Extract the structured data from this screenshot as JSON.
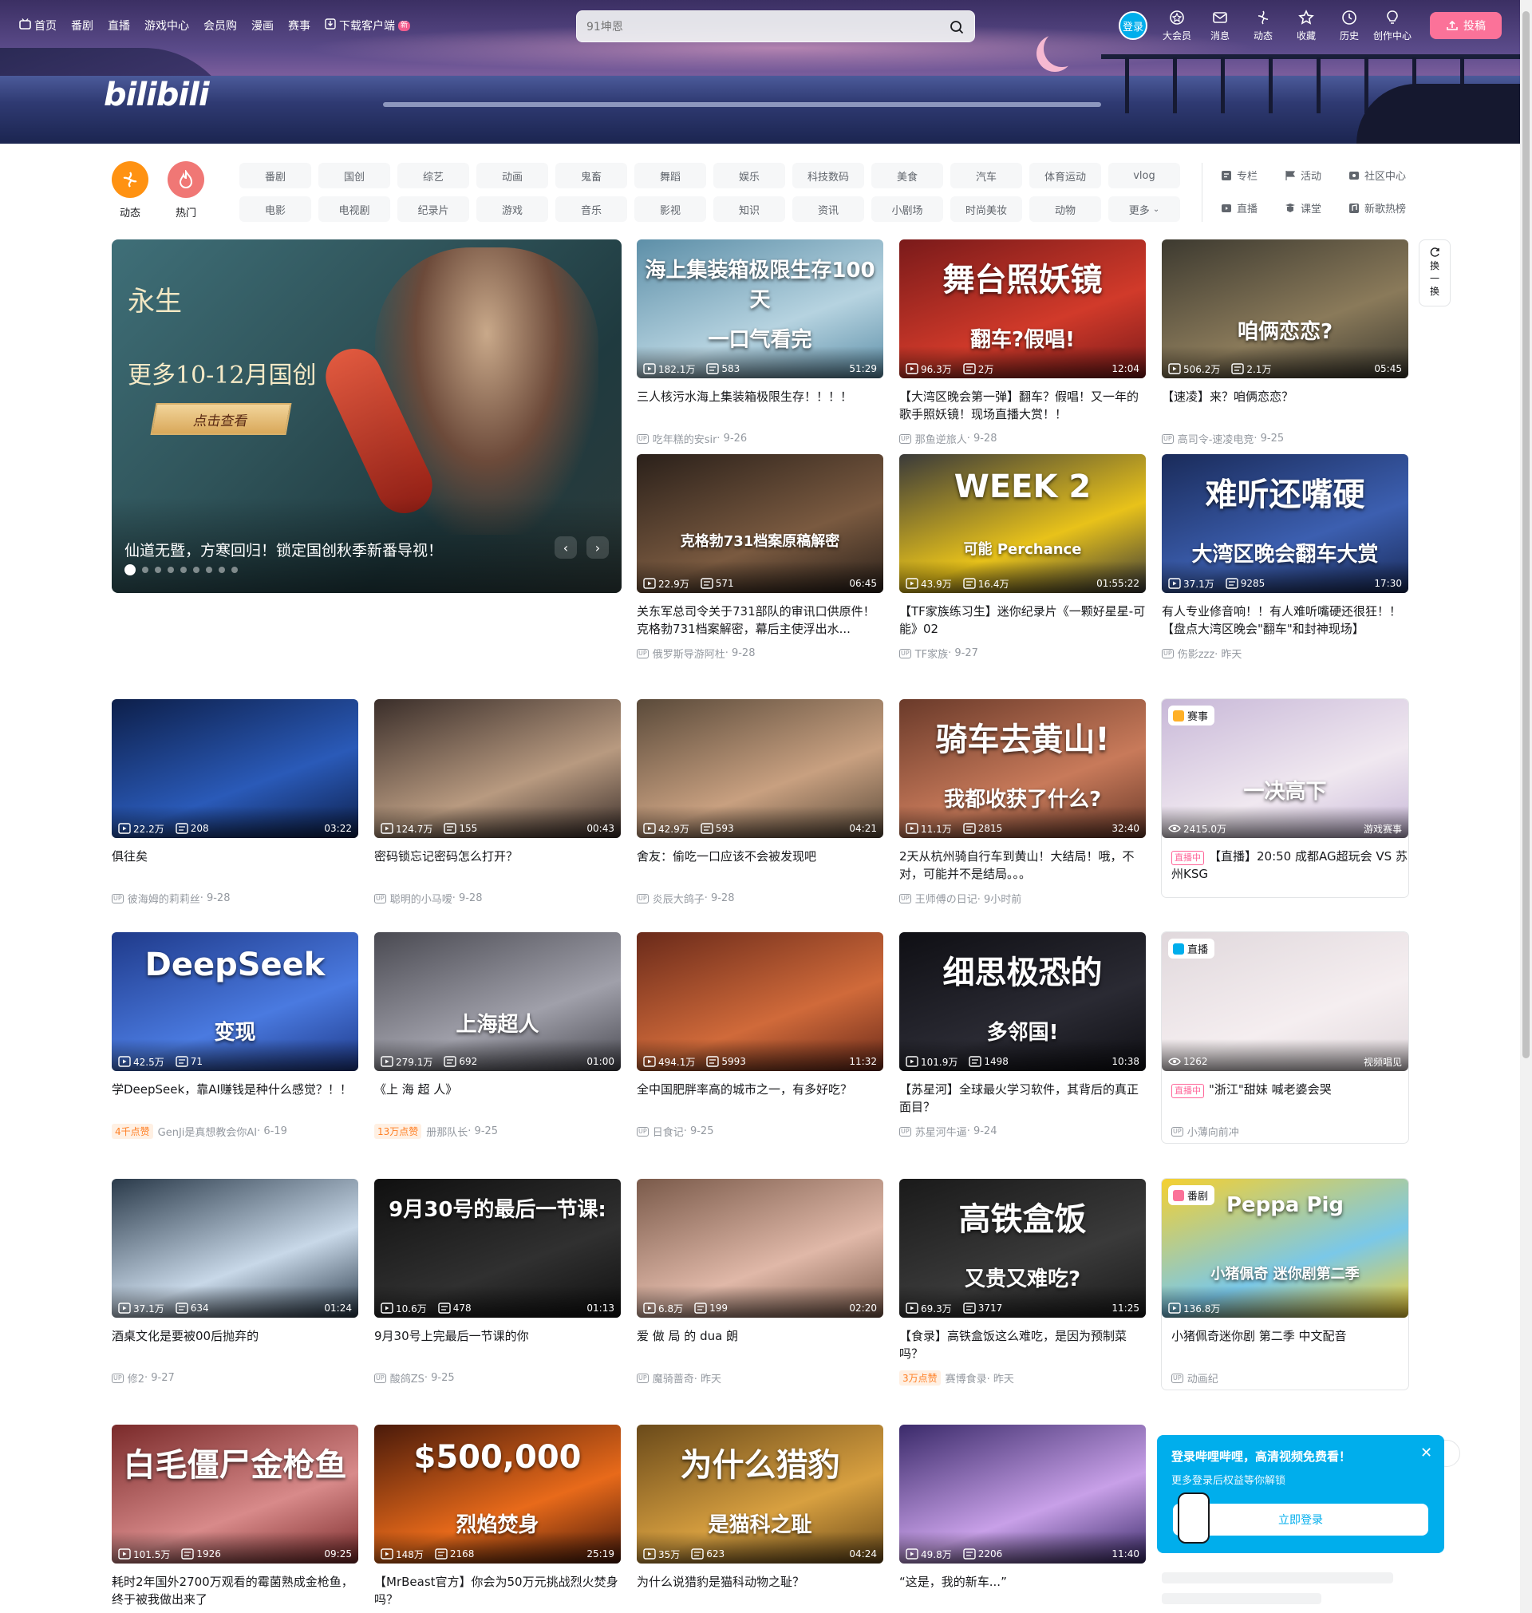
{
  "nav": {
    "left": [
      {
        "label": "首页",
        "icon": "tv-icon"
      },
      {
        "label": "番剧"
      },
      {
        "label": "直播"
      },
      {
        "label": "游戏中心"
      },
      {
        "label": "会员购"
      },
      {
        "label": "漫画"
      },
      {
        "label": "赛事"
      },
      {
        "label": "下载客户端",
        "icon": "download-icon",
        "badge": "新"
      }
    ],
    "logo": "bilibili",
    "search_placeholder": "91坤恩",
    "login": "登录",
    "right": [
      {
        "label": "大会员",
        "icon": "vip-icon"
      },
      {
        "label": "消息",
        "icon": "message-icon"
      },
      {
        "label": "动态",
        "icon": "dynamic-icon"
      },
      {
        "label": "收藏",
        "icon": "star-icon"
      },
      {
        "label": "历史",
        "icon": "history-icon"
      },
      {
        "label": "创作中心",
        "icon": "bulb-icon"
      }
    ],
    "upload": "投稿"
  },
  "quick": [
    {
      "label": "动态",
      "color": "#ff9212"
    },
    {
      "label": "热门",
      "color": "#f07775"
    }
  ],
  "channels": [
    "番剧",
    "国创",
    "综艺",
    "动画",
    "鬼畜",
    "舞蹈",
    "娱乐",
    "科技数码",
    "美食",
    "汽车",
    "体育运动",
    "vlog",
    "电影",
    "电视剧",
    "纪录片",
    "游戏",
    "音乐",
    "影视",
    "知识",
    "资讯",
    "小剧场",
    "时尚美妆",
    "动物",
    "更多"
  ],
  "links": [
    "专栏",
    "活动",
    "社区中心",
    "直播",
    "课堂",
    "新歌热榜"
  ],
  "carousel": {
    "caption": "仙道无暨，方寒回归！锁定国创秋季新番导视！",
    "art_title": "永生",
    "art_sub": "更多10-12月国创",
    "art_btn": "点击查看",
    "dots": 9,
    "active": 0
  },
  "refresh": "换一换",
  "videos": [
    {
      "views": "182.1万",
      "danmaku": "583",
      "dur": "51:29",
      "title": "三人核污水海上集装箱极限生存！！！！",
      "author": "吃年糕的安sir",
      "date": "9-26",
      "bg": "#5d8fa8",
      "bg2": "#b6d3e0",
      "overlay": "海上集装箱极限生存100天",
      "overlay2": "一口气看完"
    },
    {
      "views": "96.3万",
      "danmaku": "2万",
      "dur": "12:04",
      "title": "【大湾区晚会第一弹】翻车？假唱！又一年的歌手照妖镜！现场直播大赏！！",
      "author": "那鱼逆旅人",
      "date": "9-28",
      "bg": "#7a1a1a",
      "bg2": "#d13a2a",
      "overlay": "舞台照妖镜",
      "overlay2": "翻车?假唱!"
    },
    {
      "views": "506.2万",
      "danmaku": "2.1万",
      "dur": "05:45",
      "title": "【速凌】来？咱俩恋恋？",
      "author": "高司令-速凌电竞",
      "date": "9-25",
      "bg": "#3d3a30",
      "bg2": "#8a7a5a",
      "overlay": "",
      "overlay2": "咱俩恋恋?"
    },
    {
      "views": "22.9万",
      "danmaku": "571",
      "dur": "06:45",
      "title": "关东军总司令关于731部队的审讯口供原件！克格勃731档案解密，幕后主使浮出水...",
      "author": "俄罗斯导游阿杜",
      "date": "9-28",
      "bg": "#2a201a",
      "bg2": "#7a5a40",
      "overlay": "",
      "overlay2": "克格勃731档案原稿解密"
    },
    {
      "views": "43.9万",
      "danmaku": "16.4万",
      "dur": "01:55:22",
      "title": "【TF家族练习生】迷你纪录片《一颗好星星-可能》02",
      "author": "TF家族",
      "date": "9-27",
      "bg": "#3a3a3a",
      "bg2": "#e8c21a",
      "overlay": "WEEK 2",
      "overlay2": "可能 Perchance"
    },
    {
      "views": "37.1万",
      "danmaku": "9285",
      "dur": "17:30",
      "title": "有人专业修音响！！有人难听嘴硬还很狂！！【盘点大湾区晚会\"翻车\"和封神现场】",
      "author": "伤影zzz",
      "date": "昨天",
      "bg": "#1a2b5a",
      "bg2": "#3c5fb0",
      "overlay": "难听还嘴硬",
      "overlay2": "大湾区晚会翻车大赏"
    },
    {
      "views": "22.2万",
      "danmaku": "208",
      "dur": "03:22",
      "title": "俱往矣",
      "author": "彼海姆的莉莉丝",
      "date": "9-28",
      "bg": "#0d1f4a",
      "bg2": "#2a5ab8",
      "overlay": "",
      "overlay2": ""
    },
    {
      "views": "124.7万",
      "danmaku": "155",
      "dur": "00:43",
      "title": "密码锁忘记密码怎么打开？",
      "author": "聪明的小马嗳",
      "date": "9-28",
      "bg": "#3a2e2a",
      "bg2": "#b89a80",
      "overlay": "",
      "overlay2": ""
    },
    {
      "views": "42.9万",
      "danmaku": "593",
      "dur": "04:21",
      "title": "舍友：偷吃一口应该不会被发现吧",
      "author": "炎辰大鸽子",
      "date": "9-28",
      "bg": "#5a4a3a",
      "bg2": "#c8a080",
      "overlay": "",
      "overlay2": ""
    },
    {
      "views": "11.1万",
      "danmaku": "2815",
      "dur": "32:40",
      "title": "2天从杭州骑自行车到黄山！大结局！哦，不对，可能并不是结局。。。",
      "author": "王师傅の日记",
      "date": "9小时前",
      "bg": "#6a3a2a",
      "bg2": "#c87a5a",
      "overlay": "骑车去黄山!",
      "overlay2": "我都收获了什么?"
    },
    {
      "views": "1262",
      "danmaku": "",
      "dur": "",
      "title": "\"浙江\"甜妹 喊老婆会哭",
      "author": "小薄向前冲",
      "date": "",
      "bg": "#e0d8dc",
      "bg2": "#f5eef0",
      "overlay": "",
      "overlay2": ""
    },
    {
      "views": "42.5万",
      "danmaku": "71",
      "dur": "",
      "title": "学DeepSeek，靠AI赚钱是种什么感觉？！！",
      "author": "GenJi是真想教会你AI",
      "date": "6-19",
      "hot": "4千点赞",
      "bg": "#1f3a8a",
      "bg2": "#4a7ae0",
      "overlay": "DeepSeek",
      "overlay2": "变现"
    },
    {
      "views": "279.1万",
      "danmaku": "692",
      "dur": "01:00",
      "title": "《上 海 超 人》",
      "author": "册那队长",
      "date": "9-25",
      "hot": "13万点赞",
      "bg": "#4a4a52",
      "bg2": "#a0a0aa",
      "overlay": "",
      "overlay2": "上海超人"
    },
    {
      "views": "494.1万",
      "danmaku": "5993",
      "dur": "11:32",
      "title": "全中国肥胖率高的城市之一，有多好吃？",
      "author": "日食记",
      "date": "9-25",
      "bg": "#6a2a1a",
      "bg2": "#d06a3a",
      "overlay": "",
      "overlay2": ""
    },
    {
      "views": "101.9万",
      "danmaku": "1498",
      "dur": "10:38",
      "title": "【苏星河】全球最火学习软件，其背后的真正面目？",
      "author": "苏星河牛逼",
      "date": "9-24",
      "bg": "#0f0f14",
      "bg2": "#2a2a33",
      "overlay": "细思极恐的",
      "overlay2": "多邻国!"
    },
    {
      "views": "37.1万",
      "danmaku": "634",
      "dur": "01:24",
      "title": "酒桌文化是要被00后抛弃的",
      "author": "修2",
      "date": "9-27",
      "bg": "#2a3a4a",
      "bg2": "#c8d8e8",
      "overlay": "",
      "overlay2": ""
    },
    {
      "views": "10.6万",
      "danmaku": "478",
      "dur": "01:13",
      "title": "9月30号上完最后一节课的你",
      "author": "酸鸽ZS",
      "date": "9-25",
      "bg": "#101010",
      "bg2": "#303030",
      "overlay": "9月30号的最后一节课:",
      "overlay2": ""
    },
    {
      "views": "6.8万",
      "danmaku": "199",
      "dur": "02:20",
      "title": "爱 做 局 的 dua 朗",
      "author": "魔骑蔷奇",
      "date": "昨天",
      "bg": "#7a5a4a",
      "bg2": "#e0b8a8",
      "overlay": "",
      "overlay2": ""
    },
    {
      "views": "69.3万",
      "danmaku": "3717",
      "dur": "11:25",
      "title": "【食录】高铁盒饭这么难吃，是因为预制菜吗？",
      "author": "赛博食录",
      "date": "昨天",
      "hot": "3万点赞",
      "bg": "#1a1a1a",
      "bg2": "#3a3a3a",
      "overlay": "高铁盒饭",
      "overlay2": "又贵又难吃?"
    },
    {
      "views": "136.8万",
      "danmaku": "",
      "dur": "",
      "title": "小猪佩奇迷你剧 第二季 中文配音",
      "author": "动画纪",
      "date": "",
      "bg": "#f5d030",
      "bg2": "#7ac8e8",
      "overlay": "Peppa Pig",
      "overlay2": "小猪佩奇 迷你剧第二季"
    },
    {
      "views": "101.5万",
      "danmaku": "1926",
      "dur": "09:25",
      "title": "耗时2年国外2700万观看的霉菌熟成金枪鱼，终于被我做出来了",
      "author": "",
      "date": "",
      "bg": "#7a2a2a",
      "bg2": "#d88a8a",
      "overlay": "白毛僵尸金枪鱼",
      "overlay2": ""
    },
    {
      "views": "148万",
      "danmaku": "2168",
      "dur": "25:19",
      "title": "【MrBeast官方】你会为50万元挑战烈火焚身吗？",
      "author": "",
      "date": "",
      "bg": "#4a1a0a",
      "bg2": "#e86a1a",
      "overlay": "$500,000",
      "overlay2": "烈焰焚身"
    },
    {
      "views": "35万",
      "danmaku": "623",
      "dur": "04:24",
      "title": "为什么说猎豹是猫科动物之耻？",
      "author": "",
      "date": "",
      "bg": "#6a4a1a",
      "bg2": "#d8a040",
      "overlay": "为什么猎豹",
      "overlay2": "是猫科之耻"
    },
    {
      "views": "49.8万",
      "danmaku": "2206",
      "dur": "11:40",
      "title": "“这是，我的新车...”",
      "author": "",
      "date": "",
      "bg": "#3a2a6a",
      "bg2": "#c8a0e8",
      "overlay": "",
      "overlay2": ""
    }
  ],
  "special": {
    "esports": {
      "tag": "赛事",
      "views": "2415.0万",
      "corner": "游戏赛事",
      "live": "直播中",
      "title": "【直播】20:50 成都AG超玩会 VS 苏州KSG",
      "overlay": "一决高下"
    },
    "live": {
      "tag": "直播",
      "corner": "视频唱见",
      "live": "直播中"
    },
    "bangumi": {
      "tag": "番剧"
    }
  },
  "login_popup": {
    "title": "登录哔哩哔哩，高清视频免费看！",
    "sub": "更多登录后权益等你解锁",
    "btn": "立即登录"
  }
}
